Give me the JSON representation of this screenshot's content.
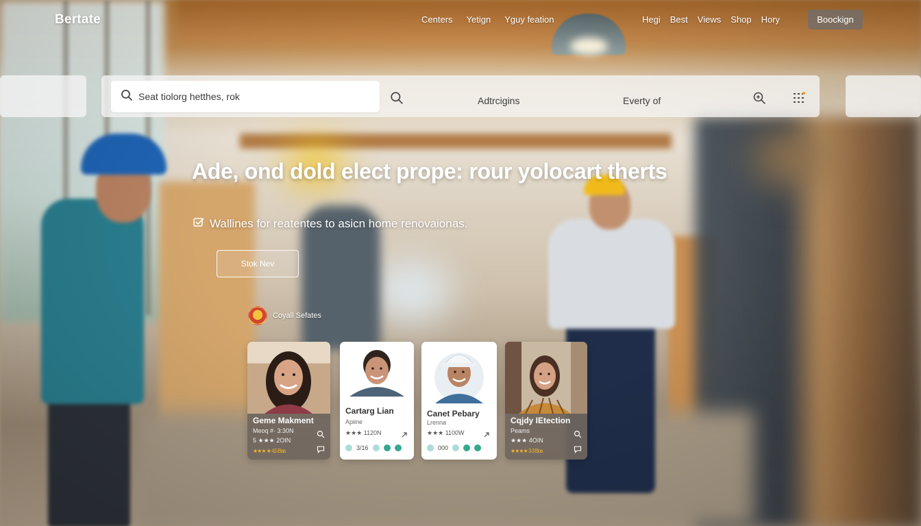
{
  "brand": "Bertate",
  "nav": {
    "left": [
      "Centers",
      "Yetign",
      "Yguy feation"
    ],
    "right": [
      "Hegi",
      "Best",
      "Views",
      "Shop",
      "Hory"
    ],
    "cta": "Boockign"
  },
  "search": {
    "placeholder": "Seat tiolorg hetthes, rok",
    "filter_1": "Adtrcigins",
    "filter_2": "Everty of"
  },
  "hero": {
    "title": "Ade, ond dold elect prope: rour yolocart therts",
    "subtitle": "Wallines for reatentes to asicn home renovaionas.",
    "button": "Stok Nev"
  },
  "pros": {
    "label": "Coyall Sefates",
    "cards": [
      {
        "name": "Geme Makment",
        "role": "Meoq #· 3:30N",
        "meta": "5 ★★★ 2OIN",
        "rating": "★★★ ★ 4,5 Bas",
        "style": "dark"
      },
      {
        "name": "Cartarg Lian",
        "role": "Apiine",
        "meta": "★★★ 1120N",
        "dots": "3/16",
        "style": "light"
      },
      {
        "name": "Canet Pebary",
        "role": "Lrenna",
        "meta": "★★★ 1100W",
        "dots": "000",
        "style": "light"
      },
      {
        "name": "Cqjdy IEtection",
        "role": "Peams",
        "meta": "★★★ 4OIN",
        "rating": "★★★★ 3-3 Bos",
        "style": "dark"
      }
    ]
  },
  "colors": {
    "accent_hat": "#1f64b5",
    "card_dark": "#70665e",
    "star": "#f4b32a",
    "teal_dot": "#34a88f"
  },
  "icons": [
    "search-icon",
    "zoom-icon",
    "grid-menu-icon",
    "chat-icon",
    "arrow-icon",
    "location-icon"
  ]
}
